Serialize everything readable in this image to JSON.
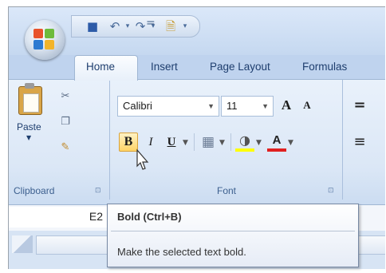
{
  "quick_access": {
    "icons": [
      "office-button",
      "save-icon",
      "undo-icon",
      "redo-icon",
      "print-preview-icon",
      "customize-qat-icon"
    ],
    "separator": "="
  },
  "tabs": [
    "Home",
    "Insert",
    "Page Layout",
    "Formulas"
  ],
  "clipboard_group": {
    "paste_label": "Paste",
    "group_label": "Clipboard",
    "launcher": "⊡"
  },
  "font_group": {
    "font_name": "Calibri",
    "font_size": "11",
    "grow_font": "A",
    "shrink_font": "A",
    "bold": "B",
    "italic": "I",
    "underline": "U",
    "group_label": "Font",
    "launcher": "⊡"
  },
  "alignment_group": {
    "top_align": "=",
    "left_align": "≡"
  },
  "formula_bar": {
    "name_box": "E2"
  },
  "tooltip": {
    "title": "Bold (Ctrl+B)",
    "description": "Make the selected text bold."
  },
  "colors": {
    "ribbon_bg": "#dbe7f6",
    "tab_text": "#1e3e6e",
    "bold_highlight": "#ffd466",
    "font_color_underline": "#e02020",
    "highlight_color": "#ffff00"
  }
}
